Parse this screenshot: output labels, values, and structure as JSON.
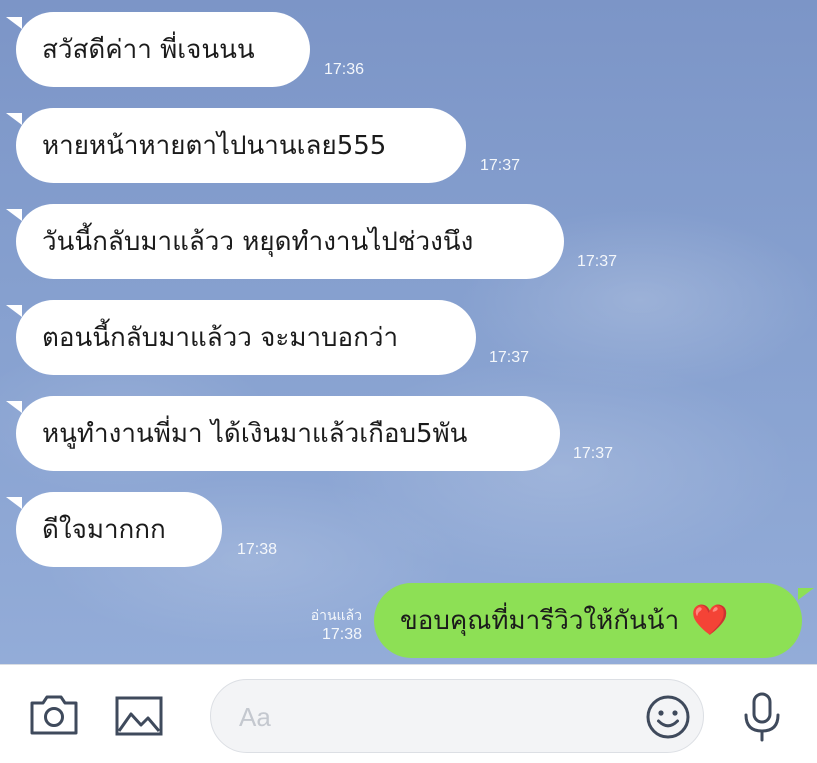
{
  "messages": [
    {
      "text": "สวัสดีค่าา พี่เจนนน",
      "time": "17:36"
    },
    {
      "text": "หายหน้าหายตาไปนานเลย555",
      "time": "17:37"
    },
    {
      "text": "วันนี้กลับมาแล้วว หยุดทำงานไปช่วงนึง",
      "time": "17:37"
    },
    {
      "text": "ตอนนี้กลับมาแล้วว จะมาบอกว่า",
      "time": "17:37"
    },
    {
      "text": "หนูทำงานพี่มา ได้เงินมาแล้วเกือบ5พัน",
      "time": "17:37"
    },
    {
      "text": "ดีใจมากกก",
      "time": "17:38"
    }
  ],
  "sent": {
    "text": "ขอบคุณที่มารีวิวให้กันน้า",
    "emoji": "❤️",
    "read_label": "อ่านแล้ว",
    "time": "17:38"
  },
  "input": {
    "placeholder": "Aa"
  },
  "toolbar": {
    "camera": "camera-icon",
    "gallery": "image-icon",
    "emoji": "smiley-icon",
    "mic": "microphone-icon"
  },
  "colors": {
    "incoming_bubble": "#ffffff",
    "outgoing_bubble": "#8de055",
    "chat_background": "#86a0cf",
    "icon": "#3f4a5c"
  }
}
